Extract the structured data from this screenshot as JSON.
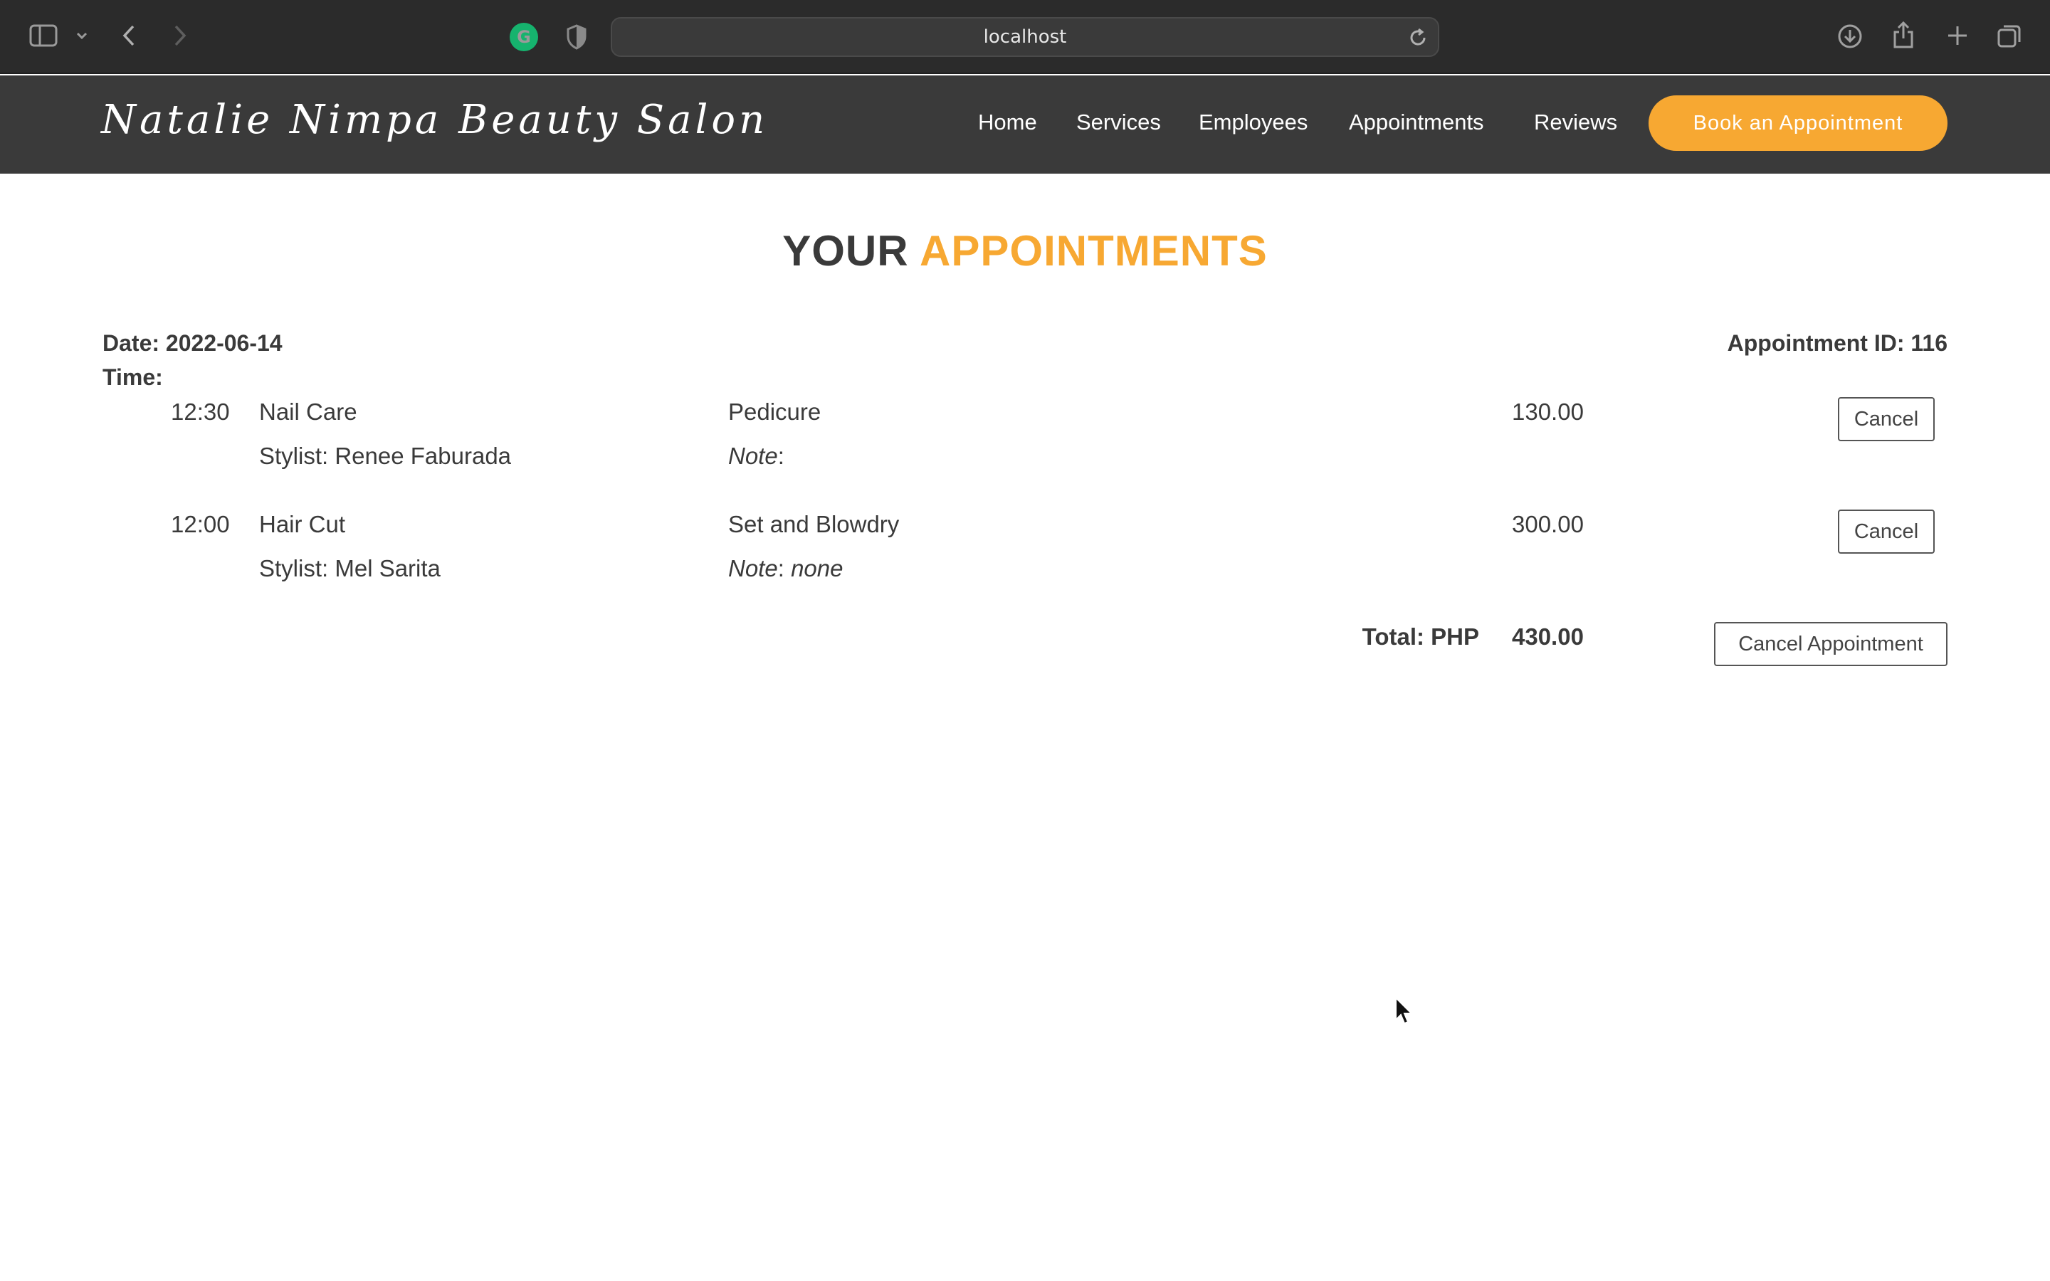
{
  "browser": {
    "url": "localhost",
    "icons": [
      "sidebar-icon",
      "chevron-down-icon",
      "back-icon",
      "forward-icon",
      "grammarly-icon",
      "shield-icon",
      "reload-icon",
      "download-icon",
      "share-icon",
      "new-tab-icon",
      "tabs-overview-icon"
    ]
  },
  "site": {
    "logo": "Natalie Nimpa Beauty Salon",
    "nav": [
      "Home",
      "Services",
      "Employees",
      "Appointments",
      "Reviews"
    ],
    "book_button": "Book an Appointment",
    "accent_color": "#f7a832",
    "header_bg": "#3a3a3a"
  },
  "page": {
    "title_part1": "YOUR",
    "title_part2": "APPOINTMENTS",
    "date_label": "Date: 2022-06-14",
    "time_label": "Time:",
    "appointment_id_label": "Appointment ID: 116",
    "appointments": [
      {
        "time": "12:30",
        "category": "Nail Care",
        "stylist": "Stylist: Renee Faburada",
        "service": "Pedicure",
        "note_label": "Note",
        "note_value": "",
        "price": "130.00",
        "cancel_label": "Cancel"
      },
      {
        "time": "12:00",
        "category": "Hair Cut",
        "stylist": "Stylist: Mel Sarita",
        "service": "Set and Blowdry",
        "note_label": "Note",
        "note_value": "none",
        "price": "300.00",
        "cancel_label": "Cancel"
      }
    ],
    "total_label": "Total: PHP",
    "total_value": "430.00",
    "cancel_appointment_label": "Cancel Appointment"
  }
}
